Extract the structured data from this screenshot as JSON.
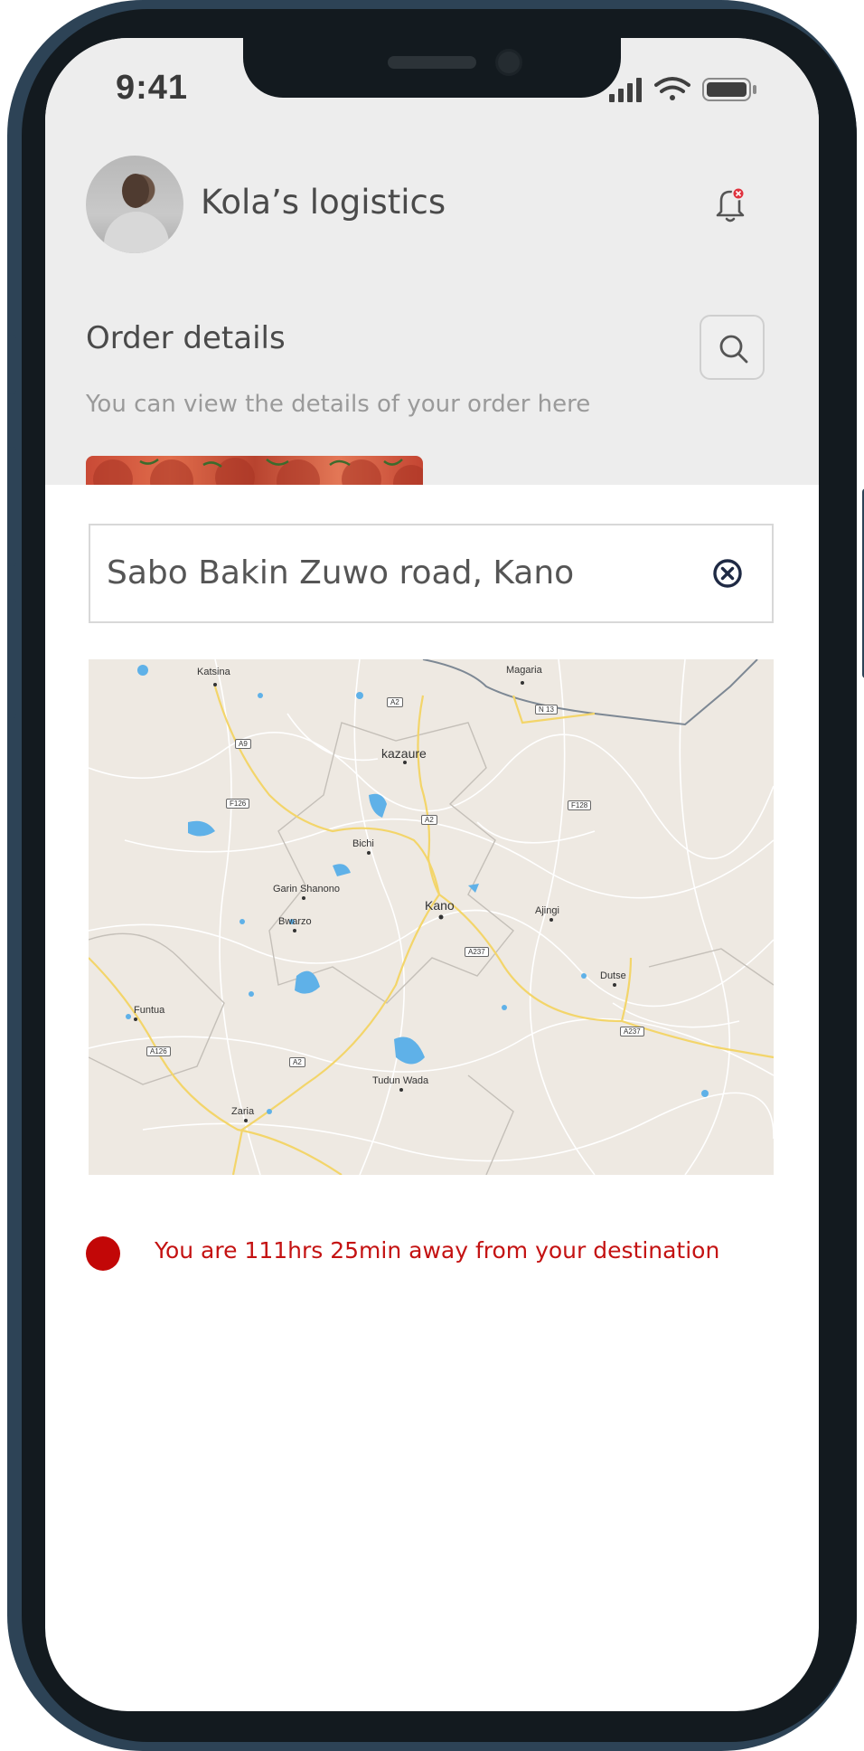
{
  "status_bar": {
    "time": "9:41"
  },
  "header": {
    "company_name": "Kola’s logistics",
    "order_title": "Order details",
    "order_subtitle": "You can view the details of your order here"
  },
  "address": {
    "value": "Sabo Bakin Zuwo road, Kano"
  },
  "map": {
    "places": [
      "Katsina",
      "Magaria",
      "kazaure",
      "Bichi",
      "Garin Shanono",
      "Kano",
      "Bwarzo",
      "Ajingi",
      "Dutse",
      "Funtua",
      "Tudun Wada",
      "Zaria"
    ],
    "routes": [
      "A2",
      "A9",
      "F126",
      "A2",
      "N 13",
      "F128",
      "A237",
      "A237",
      "A126",
      "A2"
    ]
  },
  "eta": {
    "message": "You are  111hrs 25min away from your destination",
    "dot_color": "#c20707"
  },
  "colors": {
    "accent_red": "#c41212",
    "top_background": "#ededed"
  },
  "icons": {
    "bell": "notification-bell-icon",
    "search": "search-icon",
    "clear": "close-circle-icon"
  }
}
